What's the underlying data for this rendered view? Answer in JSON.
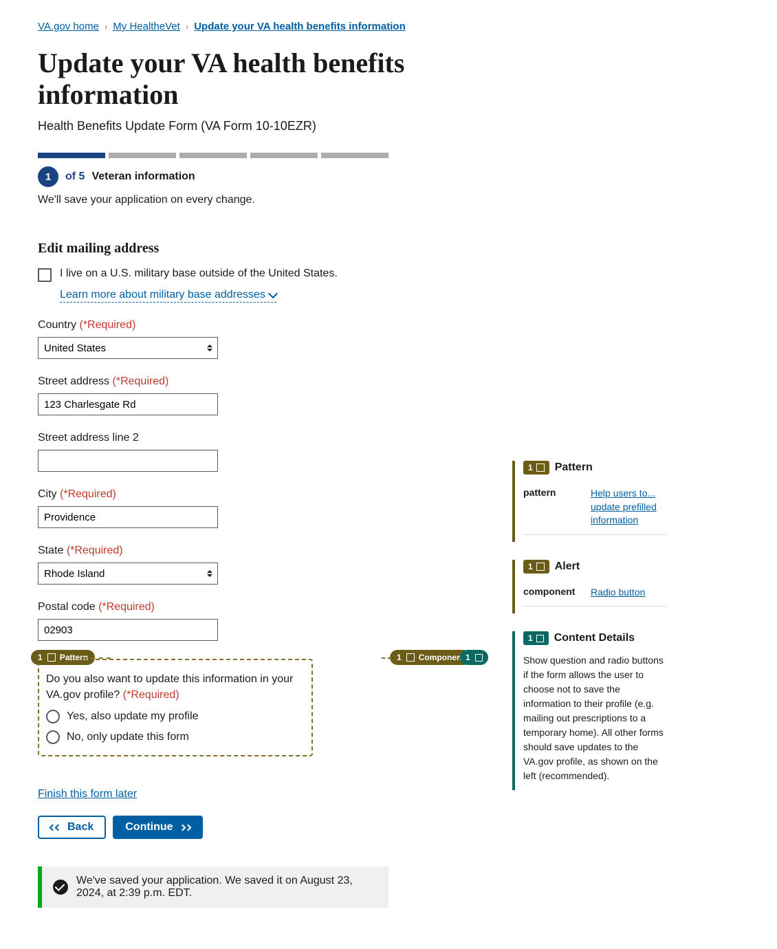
{
  "breadcrumbs": {
    "home": "VA.gov home",
    "mhv": "My HealtheVet",
    "current": "Update your VA health benefits information"
  },
  "heading": "Update your VA health benefits information",
  "subtitle": "Health Benefits Update Form (VA Form 10-10EZR)",
  "progress": {
    "step_num": "1",
    "of": "of 5",
    "step_name": "Veteran information",
    "save_note": "We'll save your application on every change."
  },
  "section_title": "Edit mailing address",
  "military_base": {
    "label": "I live on a U.S. military base outside of the United States.",
    "learn_more": "Learn more about military base addresses"
  },
  "required_text": "(*Required)",
  "fields": {
    "country": {
      "label": "Country",
      "value": "United States"
    },
    "street": {
      "label": "Street address",
      "value": "123 Charlesgate Rd"
    },
    "street2": {
      "label": "Street address line 2",
      "value": ""
    },
    "city": {
      "label": "City",
      "value": "Providence"
    },
    "state": {
      "label": "State",
      "value": "Rhode Island"
    },
    "postal": {
      "label": "Postal code",
      "value": "02903"
    }
  },
  "radio": {
    "legend": "Do you also want to update this information in your VA.gov profile?",
    "opt_yes": "Yes, also update my profile",
    "opt_no": "No, only update this form"
  },
  "links": {
    "finish_later": "Finish this form later"
  },
  "buttons": {
    "back": "Back",
    "continue": "Continue"
  },
  "banner": {
    "text": "We've saved your application. We saved it on August 23, 2024, at 2:39 p.m. EDT."
  },
  "tags": {
    "pattern_num": "1",
    "pattern_label": "Pattern",
    "component_num": "1",
    "component_label": "Component",
    "content_num": "1"
  },
  "cards": {
    "pattern": {
      "title": "Pattern",
      "key": "pattern",
      "val": "Help users to... update prefilled information"
    },
    "alert": {
      "title": "Alert",
      "key": "component",
      "val": "Radio button"
    },
    "content": {
      "title": "Content Details",
      "body": "Show question and radio buttons if the form allows the user to choose not to save the information to their profile (e.g. mailing out prescriptions to a temporary home). All other forms should save updates to the VA.gov profile, as shown on the left (recommended)."
    }
  }
}
